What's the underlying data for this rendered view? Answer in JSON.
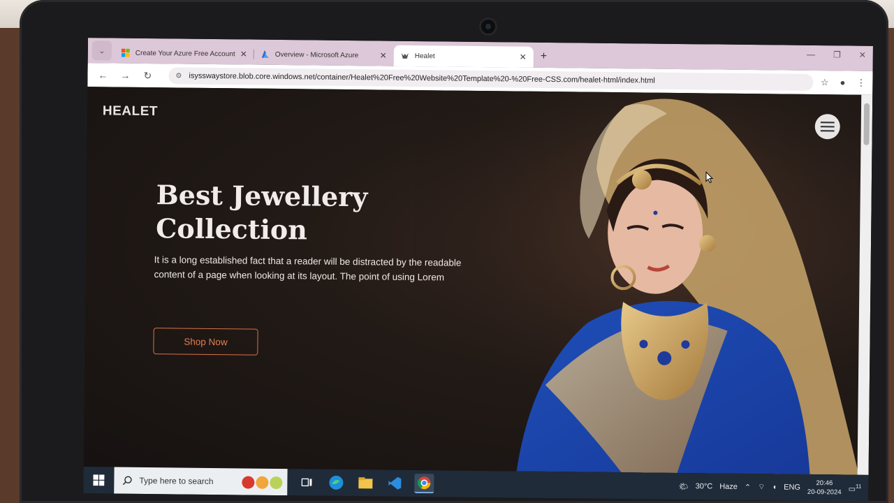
{
  "browser": {
    "tabs": [
      {
        "label": "Create Your Azure Free Account",
        "favicon": "microsoft-icon",
        "active": false
      },
      {
        "label": "Overview - Microsoft Azure",
        "favicon": "azure-icon",
        "active": false
      },
      {
        "label": "Healet",
        "favicon": "healet-icon",
        "active": true
      }
    ],
    "url": "isysswaystore.blob.core.windows.net/container/Healet%20Free%20Website%20Template%20-%20Free-CSS.com/healet-html/index.html"
  },
  "page": {
    "brand": "HEALET",
    "hero_title_line1": "Best Jewellery",
    "hero_title_line2": "Collection",
    "hero_text": "It is a long established fact that a reader will be distracted by the readable content of a page when looking at its layout. The point of using Lorem",
    "shop_button": "Shop Now"
  },
  "taskbar": {
    "search_placeholder": "Type here to search",
    "weather_temp": "30°C",
    "weather_desc": "Haze",
    "language": "ENG",
    "time": "20:46",
    "date": "20-09-2024",
    "notification_count": "11"
  },
  "colors": {
    "accent": "#e37d52",
    "tabstrip": "#dcc8d8",
    "taskbar": "#1f2b38"
  }
}
